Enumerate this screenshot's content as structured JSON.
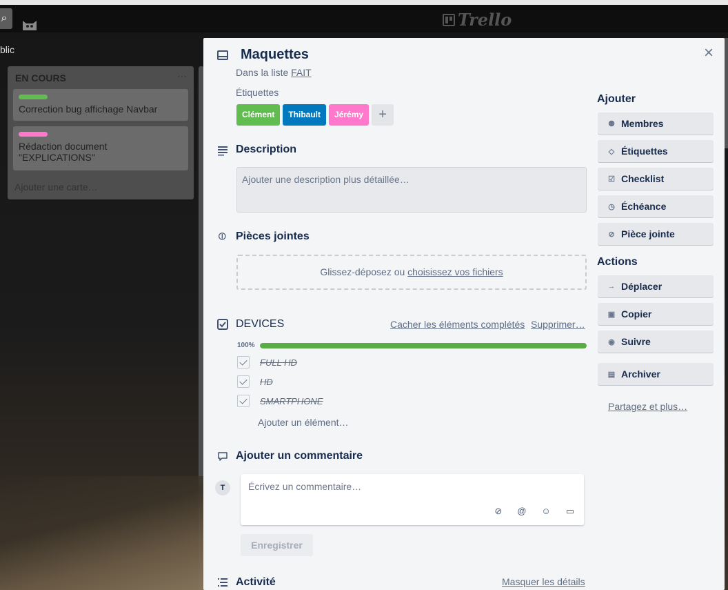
{
  "board": {
    "search_icon": "search-icon",
    "app_logo": "Trello",
    "visibility_fragment": "blic",
    "list": {
      "title": "EN COURS",
      "menu": "···",
      "cards": [
        {
          "label_color": "#61bd4f",
          "text": "Correction bug affichage Navbar"
        },
        {
          "label_color": "#ff78cb",
          "text": "Rédaction document \"EXPLICATIONS\""
        }
      ],
      "add_card": "Ajouter une carte…"
    }
  },
  "card": {
    "title": "Maquettes",
    "in_list_prefix": "Dans la liste",
    "in_list_name": "FAIT",
    "close_icon": "×",
    "labels_title": "Étiquettes",
    "labels": [
      {
        "name": "Clément",
        "color": "#61bd4f"
      },
      {
        "name": "Thibault",
        "color": "#0079bf"
      },
      {
        "name": "Jérémy",
        "color": "#ff78cb"
      }
    ],
    "add_label": "+",
    "description": {
      "title": "Description",
      "placeholder": "Ajouter une description plus détaillée…"
    },
    "attachments": {
      "title": "Pièces jointes",
      "drop_text": "Glissez-déposez ou",
      "choose_link": "choisissez vos fichiers"
    },
    "checklist": {
      "title": "DEVICES",
      "hide_completed": "Cacher les éléments complétés",
      "delete": "Supprimer…",
      "percent_label": "100%",
      "progress": 1.0,
      "items": [
        {
          "text": "FULL HD",
          "checked": true
        },
        {
          "text": "HD",
          "checked": true
        },
        {
          "text": "SMARTPHONE",
          "checked": true
        }
      ],
      "add_item": "Ajouter un élément…"
    },
    "comment": {
      "title": "Ajouter un commentaire",
      "avatar_initial": "T",
      "placeholder": "Écrivez un commentaire…",
      "save": "Enregistrer"
    },
    "activity": {
      "title": "Activité",
      "toggle_details": "Masquer les détails"
    }
  },
  "sidebar": {
    "add_title": "Ajouter",
    "add_buttons": [
      {
        "label": "Membres",
        "icon": "person-icon"
      },
      {
        "label": "Étiquettes",
        "icon": "tag-icon"
      },
      {
        "label": "Checklist",
        "icon": "checkbox-icon"
      },
      {
        "label": "Échéance",
        "icon": "clock-icon"
      },
      {
        "label": "Pièce jointe",
        "icon": "paperclip-icon"
      }
    ],
    "actions_title": "Actions",
    "action_buttons": [
      {
        "label": "Déplacer",
        "icon": "arrow-right-icon"
      },
      {
        "label": "Copier",
        "icon": "copy-icon"
      },
      {
        "label": "Suivre",
        "icon": "eye-icon"
      },
      {
        "label": "Archiver",
        "icon": "archive-icon"
      }
    ],
    "share_link": "Partagez et plus…"
  },
  "colors": {
    "progress": "#5aac44",
    "modal_bg": "#f4f5f7"
  }
}
